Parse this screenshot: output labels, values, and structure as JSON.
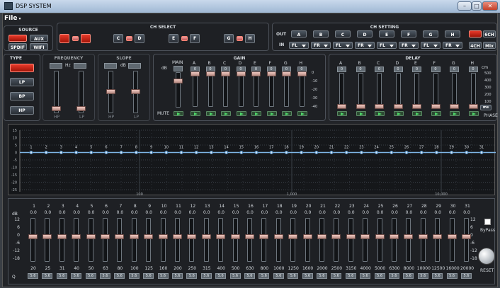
{
  "window": {
    "title": "DSP SYSTEM",
    "min": "–",
    "max": "□",
    "close": "✕"
  },
  "menu": {
    "file": "File"
  },
  "source": {
    "title": "SOURCE",
    "buttons": [
      "",
      "AUX",
      "SPDIF",
      "WIFI"
    ]
  },
  "ch_select": {
    "title": "CH SELECT",
    "pairs": [
      [
        "",
        ""
      ],
      [
        "C",
        "D"
      ],
      [
        "E",
        "F"
      ],
      [
        "G",
        "H"
      ]
    ]
  },
  "ch_setting": {
    "title": "CH SETTING",
    "out_label": "OUT",
    "in_label": "IN",
    "outs": [
      "A",
      "B",
      "C",
      "D",
      "E",
      "F",
      "G",
      "H"
    ],
    "ins": [
      "FL",
      "FR",
      "FL",
      "FR",
      "FL",
      "FR",
      "FL",
      "FR"
    ],
    "mode_buttons": [
      "",
      "6CH",
      "4CH",
      "Mix"
    ]
  },
  "type": {
    "title": "TYPE",
    "buttons": [
      "",
      "LP",
      "BP",
      "HP"
    ]
  },
  "frequency": {
    "title": "FREQUENCY",
    "unit": "Hz",
    "hp": "HP",
    "lp": "LP"
  },
  "slope": {
    "title": "SLOPE",
    "unit": "dB",
    "hp": "HP",
    "lp": "LP"
  },
  "gain": {
    "title": "GAIN",
    "db": "dB",
    "main": "MAIN",
    "mute": "MUTE",
    "channels": [
      "A",
      "B",
      "C",
      "D",
      "E",
      "F",
      "G",
      "H"
    ],
    "values": [
      "0",
      "0",
      "0",
      "0",
      "0",
      "0",
      "0",
      "0"
    ],
    "scale": [
      "0",
      "-10",
      "-20",
      "-30",
      "-40"
    ]
  },
  "delay": {
    "title": "DELAY",
    "channels": [
      "A",
      "B",
      "C",
      "D",
      "E",
      "F",
      "G",
      "H"
    ],
    "values": [
      "0",
      "0",
      "0",
      "0",
      "0",
      "0",
      "0",
      "0"
    ],
    "unit_cm": "cm",
    "unit_ms": "ms",
    "phase": "PHASE",
    "scale": [
      "500",
      "400",
      "300",
      "200",
      "100"
    ]
  },
  "graph": {
    "yticks": [
      "15",
      "10",
      "5",
      "0",
      "-5",
      "-10",
      "-15",
      "-20",
      "-25"
    ],
    "xticks": [
      "100",
      "1,000",
      "10,000"
    ],
    "points": [
      "1",
      "2",
      "3",
      "4",
      "5",
      "6",
      "7",
      "8",
      "9",
      "10",
      "11",
      "12",
      "13",
      "14",
      "15",
      "16",
      "17",
      "18",
      "19",
      "20",
      "21",
      "22",
      "23",
      "24",
      "25",
      "26",
      "27",
      "28",
      "29",
      "30",
      "31"
    ]
  },
  "eq": {
    "db": "dB",
    "q": "Q",
    "bands": [
      "1",
      "2",
      "3",
      "4",
      "5",
      "6",
      "7",
      "8",
      "9",
      "10",
      "11",
      "12",
      "13",
      "14",
      "15",
      "16",
      "17",
      "18",
      "19",
      "20",
      "21",
      "22",
      "23",
      "24",
      "25",
      "26",
      "27",
      "28",
      "29",
      "30",
      "31"
    ],
    "gain": "0.0",
    "freqs": [
      "20",
      "25",
      "31",
      "40",
      "50",
      "63",
      "80",
      "100",
      "125",
      "160",
      "200",
      "250",
      "315",
      "400",
      "500",
      "630",
      "800",
      "1000",
      "1250",
      "1600",
      "2000",
      "2500",
      "3150",
      "4000",
      "5000",
      "6300",
      "8000",
      "10000",
      "12500",
      "16000",
      "20000"
    ],
    "qval": "5.6",
    "scale": [
      "12",
      "6",
      "0",
      "-6",
      "-12",
      "-18"
    ],
    "bypass": "ByPass",
    "reset": "RESET"
  }
}
